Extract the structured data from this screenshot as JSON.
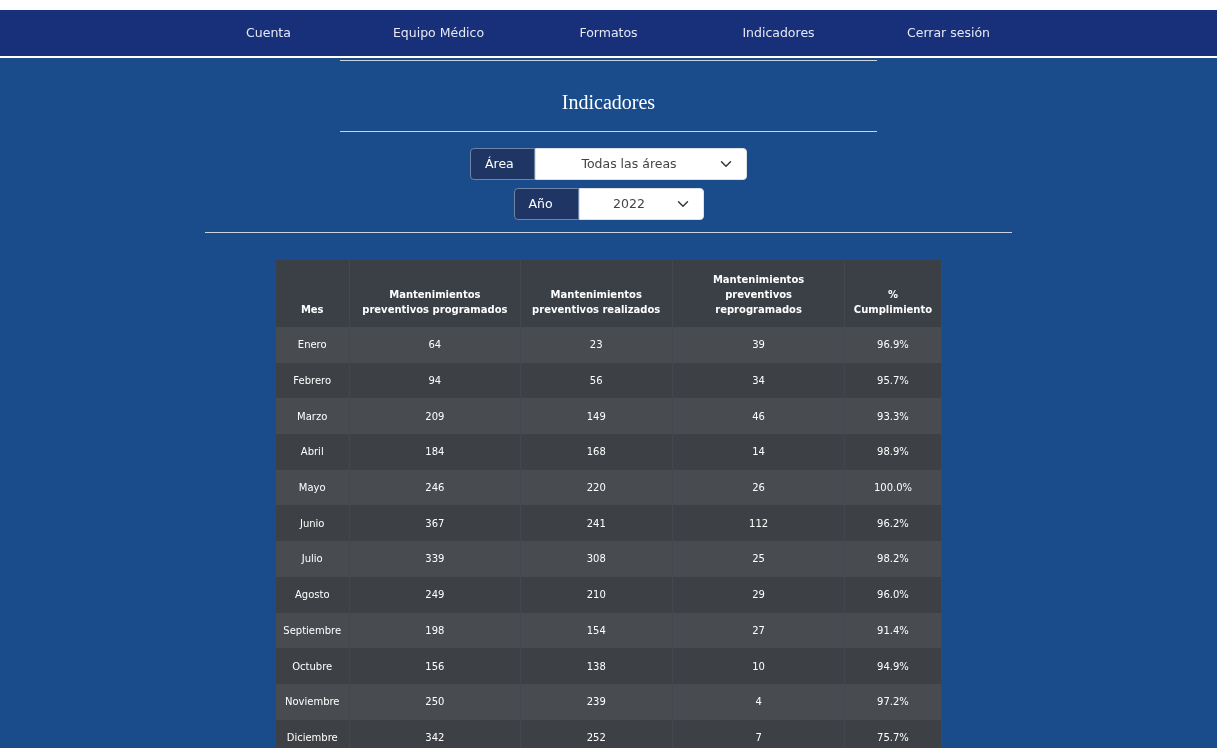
{
  "nav": [
    {
      "label": "Cuenta"
    },
    {
      "label": "Equipo Médico"
    },
    {
      "label": "Formatos"
    },
    {
      "label": "Indicadores"
    },
    {
      "label": "Cerrar sesión"
    }
  ],
  "title": "Indicadores",
  "filters": [
    {
      "label": "Área",
      "value": "Todas las áreas"
    },
    {
      "label": "Año",
      "value": "2022"
    }
  ],
  "table": {
    "columns": [
      "Mes",
      "Mantenimientos preventivos programados",
      "Mantenimientos preventivos realizados",
      "Mantenimientos preventivos reprogramados",
      "% Cumplimiento"
    ],
    "rows": [
      [
        "Enero",
        "64",
        "23",
        "39",
        "96.9%"
      ],
      [
        "Febrero",
        "94",
        "56",
        "34",
        "95.7%"
      ],
      [
        "Marzo",
        "209",
        "149",
        "46",
        "93.3%"
      ],
      [
        "Abril",
        "184",
        "168",
        "14",
        "98.9%"
      ],
      [
        "Mayo",
        "246",
        "220",
        "26",
        "100.0%"
      ],
      [
        "Junio",
        "367",
        "241",
        "112",
        "96.2%"
      ],
      [
        "Julio",
        "339",
        "308",
        "25",
        "98.2%"
      ],
      [
        "Agosto",
        "249",
        "210",
        "29",
        "96.0%"
      ],
      [
        "Septiembre",
        "198",
        "154",
        "27",
        "91.4%"
      ],
      [
        "Octubre",
        "156",
        "138",
        "10",
        "94.9%"
      ],
      [
        "Noviembre",
        "250",
        "239",
        "4",
        "97.2%"
      ],
      [
        "Diciembre",
        "342",
        "252",
        "7",
        "75.7%"
      ]
    ]
  }
}
